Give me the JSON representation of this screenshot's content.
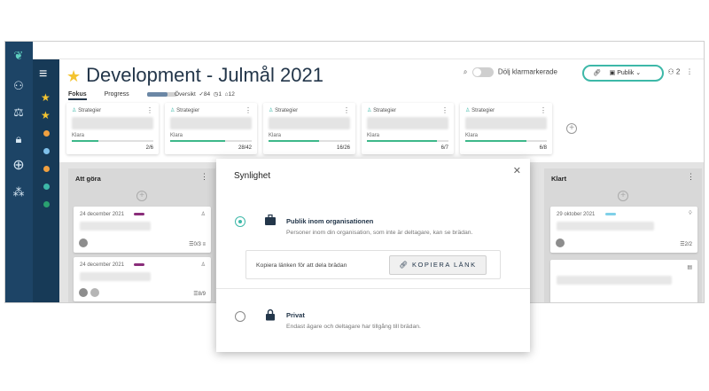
{
  "header": {
    "title": "Development - Julmål 2021",
    "tabs": [
      "Fokus",
      "Progress"
    ],
    "progress_fraction": 0.7,
    "stats_label": "Översikt",
    "stats": [
      "84",
      "1",
      "12"
    ],
    "hide_completed": "Dölj klarmarkerade",
    "visibility": "Publik",
    "members": "2"
  },
  "goals": [
    {
      "category": "Strategier",
      "status": "Klara",
      "count": "2/6",
      "fraction": 0.33
    },
    {
      "category": "Strategier",
      "status": "Klara",
      "count": "28/42",
      "fraction": 0.67
    },
    {
      "category": "Strategier",
      "status": "Klara",
      "count": "16/26",
      "fraction": 0.62
    },
    {
      "category": "Strategier",
      "status": "Klara",
      "count": "6/7",
      "fraction": 0.86
    },
    {
      "category": "Strategier",
      "status": "Klara",
      "count": "6/8",
      "fraction": 0.75
    }
  ],
  "lanes": [
    {
      "title": "Att göra"
    },
    {
      "title": "Klart"
    }
  ],
  "cards": [
    {
      "date": "24 december 2021",
      "meta": "0/3"
    },
    {
      "date": "24 december 2021",
      "meta": "8/9"
    },
    {
      "date": "29 oktober 2021",
      "meta": "2/2"
    }
  ],
  "modal": {
    "title": "Synlighet",
    "option_public_title": "Publik inom organisationen",
    "option_public_desc": "Personer inom din organisation, som inte är deltagare, kan se brädan.",
    "share_label": "Kopiera länken för att dela brädan",
    "copy_button": "KOPIERA LÄNK",
    "option_private_title": "Privat",
    "option_private_desc": "Endast ägare och deltagare har tillgång till brädan."
  },
  "colors": {
    "accent": "#3db8a8",
    "navy": "#1d4466",
    "tag_purple": "#8a2d7a",
    "tag_blue": "#7fd0e8"
  }
}
